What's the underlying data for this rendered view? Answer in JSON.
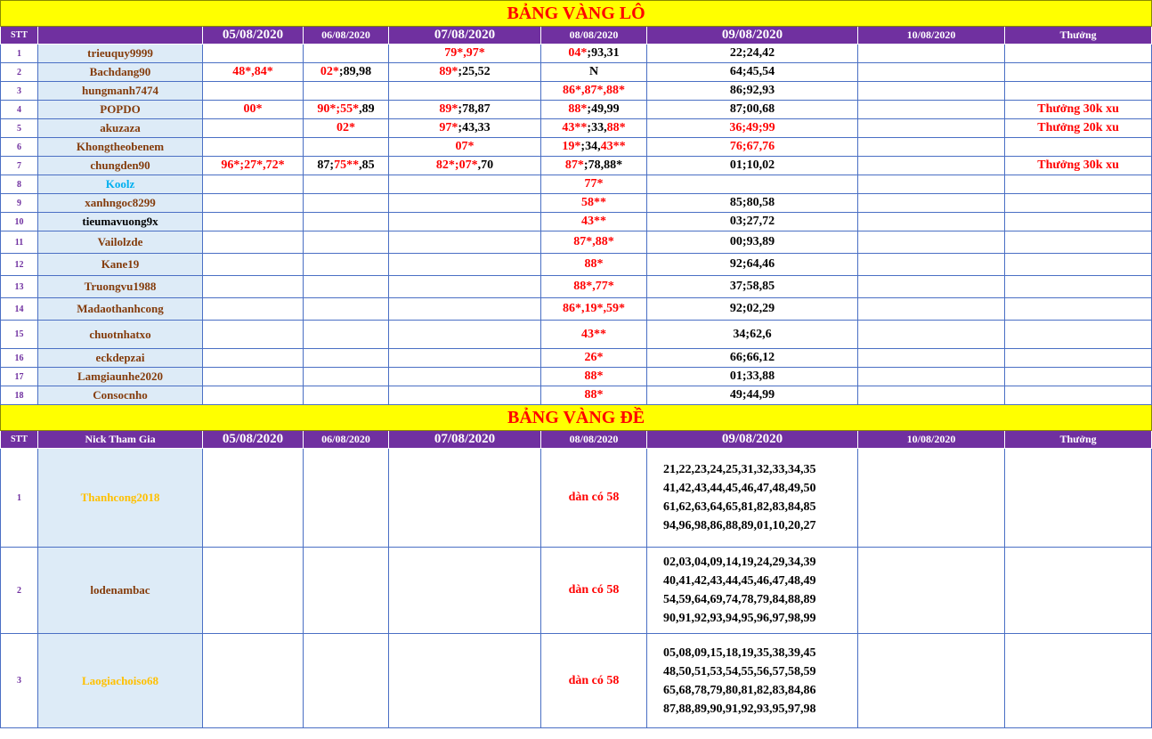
{
  "lo": {
    "title": "BẢNG VÀNG LÔ",
    "headers": {
      "stt": "STT",
      "nick": "",
      "d1": "05/08/2020",
      "d2": "06/08/2020",
      "d3": "07/08/2020",
      "d4": "08/08/2020",
      "d5": "09/08/2020",
      "d6": "10/08/2020",
      "prize": "Thưởng"
    },
    "rows": [
      {
        "stt": "1",
        "nick": "trieuquy9999",
        "d1": "",
        "d2": "",
        "d3": "79*,97*",
        "d4a": "04*",
        "d4b": ";93,31",
        "d5": "22;24,42",
        "prize": ""
      },
      {
        "stt": "2",
        "nick": "Bachdang90",
        "d1": "48*,84*",
        "d2a": "02*",
        "d2b": ";89,98",
        "d3a": "89*",
        "d3b": ";25,52",
        "d4": "N",
        "d5": "64;45,54",
        "prize": ""
      },
      {
        "stt": "3",
        "nick": "hungmanh7474",
        "d1": "",
        "d2": "",
        "d3": "",
        "d4": "86*,87*,88*",
        "d5": "86;92,93",
        "prize": ""
      },
      {
        "stt": "4",
        "nick": "POPDO",
        "d1": "00*",
        "d2a": "90*;55*",
        "d2b": ",89",
        "d3a": "89*",
        "d3b": ";78,87",
        "d4a": "88*",
        "d4b": ";49,99",
        "d5": "87;00,68",
        "prize": "Thưởng 30k xu"
      },
      {
        "stt": "5",
        "nick": "akuzaza",
        "d1": "",
        "d2": "02*",
        "d3a": "97*",
        "d3b": ";43,33",
        "d4a": "43**",
        "d4b": ";33,",
        "d4c": "88*",
        "d5": "36;49;99",
        "prize": "Thưởng 20k xu"
      },
      {
        "stt": "6",
        "nick": "Khongtheobenem",
        "d1": "",
        "d2": "",
        "d3": "07*",
        "d4a": "19*",
        "d4b": ";34,",
        "d4c": "43**",
        "d5": "76;67,76",
        "prize": ""
      },
      {
        "stt": "7",
        "nick": "chungden90",
        "d1": "96*;27*,72*",
        "d2a": "87;",
        "d2b": "75**",
        "d2c": ",85",
        "d3a": "82*;07*",
        "d3b": ",70",
        "d4a": "87*",
        "d4b": ";78,88*",
        "d5": "01;10,02",
        "prize": "Thưởng 30k xu"
      },
      {
        "stt": "8",
        "nick": "Koolz",
        "d1": "",
        "d2": "",
        "d3": "",
        "d4": "77*",
        "d5": "",
        "prize": ""
      },
      {
        "stt": "9",
        "nick": "xanhngoc8299",
        "d1": "",
        "d2": "",
        "d3": "",
        "d4": "58**",
        "d5": "85;80,58",
        "prize": ""
      },
      {
        "stt": "10",
        "nick": "tieumavuong9x",
        "d1": "",
        "d2": "",
        "d3": "",
        "d4": "43**",
        "d5": "03;27,72",
        "prize": ""
      },
      {
        "stt": "11",
        "nick": "Vailolzde",
        "d1": "",
        "d2": "",
        "d3": "",
        "d4": "87*,88*",
        "d5": "00;93,89",
        "prize": ""
      },
      {
        "stt": "12",
        "nick": "Kane19",
        "d1": "",
        "d2": "",
        "d3": "",
        "d4": "88*",
        "d5": "92;64,46",
        "prize": ""
      },
      {
        "stt": "13",
        "nick": "Truongvu1988",
        "d1": "",
        "d2": "",
        "d3": "",
        "d4": "88*,77*",
        "d5": "37;58,85",
        "prize": ""
      },
      {
        "stt": "14",
        "nick": "Madaothanhcong",
        "d1": "",
        "d2": "",
        "d3": "",
        "d4": "86*,19*,59*",
        "d5": "92;02,29",
        "prize": ""
      },
      {
        "stt": "15",
        "nick": "chuotnhatxo",
        "d1": "",
        "d2": "",
        "d3": "",
        "d4": "43**",
        "d5": "34;62,6",
        "prize": ""
      },
      {
        "stt": "16",
        "nick": "eckdepzai",
        "d1": "",
        "d2": "",
        "d3": "",
        "d4": "26*",
        "d5": "66;66,12",
        "prize": ""
      },
      {
        "stt": "17",
        "nick": "Lamgiaunhe2020",
        "d1": "",
        "d2": "",
        "d3": "",
        "d4": "88*",
        "d5": "01;33,88",
        "prize": ""
      },
      {
        "stt": "18",
        "nick": "Consocnho",
        "d1": "",
        "d2": "",
        "d3": "",
        "d4": "88*",
        "d5": "49;44,99",
        "prize": ""
      }
    ]
  },
  "de": {
    "title": "BẢNG VÀNG ĐỀ",
    "headers": {
      "stt": "STT",
      "nick": "Nick Tham Gia",
      "d1": "05/08/2020",
      "d2": "06/08/2020",
      "d3": "07/08/2020",
      "d4": "08/08/2020",
      "d5": "09/08/2020",
      "d6": "10/08/2020",
      "prize": "Thưởng"
    },
    "rows": [
      {
        "stt": "1",
        "nick": "Thanhcong2018",
        "d4": "dàn có 58",
        "lines": [
          "21,22,23,24,25,31,32,33,34,35",
          "41,42,43,44,45,46,47,48,49,50",
          "61,62,63,64,65,81,82,83,84,85",
          "94,96,98,86,88,89,01,10,20,27"
        ]
      },
      {
        "stt": "2",
        "nick": "lodenambac",
        "d4": "dàn có 58",
        "lines": [
          "02,03,04,09,14,19,24,29,34,39",
          "40,41,42,43,44,45,46,47,48,49",
          "54,59,64,69,74,78,79,84,88,89",
          "90,91,92,93,94,95,96,97,98,99"
        ]
      },
      {
        "stt": "3",
        "nick": "Laogiachoiso68",
        "d4": "dàn có 58",
        "lines": [
          "05,08,09,15,18,19,35,38,39,45",
          "48,50,51,53,54,55,56,57,58,59",
          "65,68,78,79,80,81,82,83,84,86",
          "87,88,89,90,91,92,93,95,97,98"
        ]
      }
    ]
  },
  "colors": {
    "banner_bg": "#ffff00",
    "banner_text": "#ff0000",
    "header_bg": "#7030a0",
    "nick_bg": "#ddebf7",
    "highlight": "#ff0000"
  }
}
